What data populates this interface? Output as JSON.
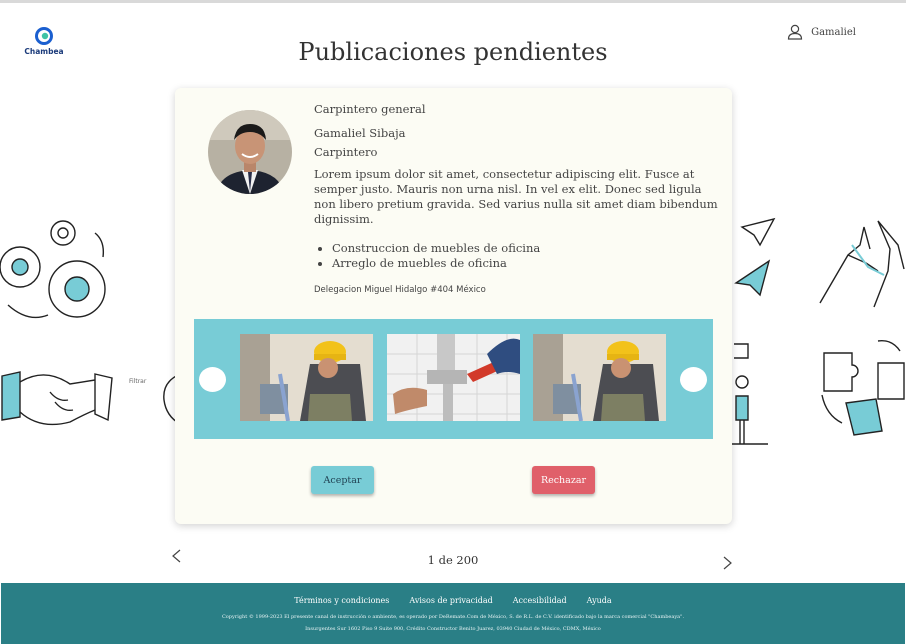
{
  "header": {
    "logo_text": "Chambea",
    "user_name": "Gamaliel",
    "page_title": "Publicaciones pendientes"
  },
  "filter_label": "Filtrar",
  "post": {
    "job_title": "Carpintero general",
    "person_name": "Gamaliel Sibaja",
    "trade": "Carpintero",
    "description": "Lorem ipsum dolor sit amet, consectetur adipiscing elit. Fusce at semper justo. Mauris non urna nisl. In vel ex elit. Donec sed ligula non libero pretium gravida. Sed varius nulla sit amet diam bibendum dignissim.",
    "skills": [
      "Construccion de muebles de oficina",
      "Arreglo de muebles de oficina"
    ],
    "address": "Delegacion Miguel Hidalgo #404 México"
  },
  "actions": {
    "accept": "Aceptar",
    "reject": "Rechazar"
  },
  "pagination": {
    "text": "1 de 200"
  },
  "footer": {
    "links": [
      "Términos y condiciones",
      "Avisos de privacidad",
      "Accesibilidad",
      "Ayuda"
    ],
    "copyright": "Copyright © 1999-2023 El presente canal de instrucción o ambiente, es operado por DeRemate.Com de México, S. de R.L. de C.V. identificado bajo la marca comercial \"Chambeaya\".",
    "address": "Insurgentes Sur 1602 Piso 9 Suite 900, Crédito Constructor Benito Juarez, 03940 Ciudad de México, CDMX, México"
  },
  "colors": {
    "accent": "#78ccd6",
    "reject": "#e0606a",
    "footer": "#2a7f86"
  },
  "icons": [
    "user-icon",
    "chevron-left-icon",
    "chevron-right-icon"
  ]
}
